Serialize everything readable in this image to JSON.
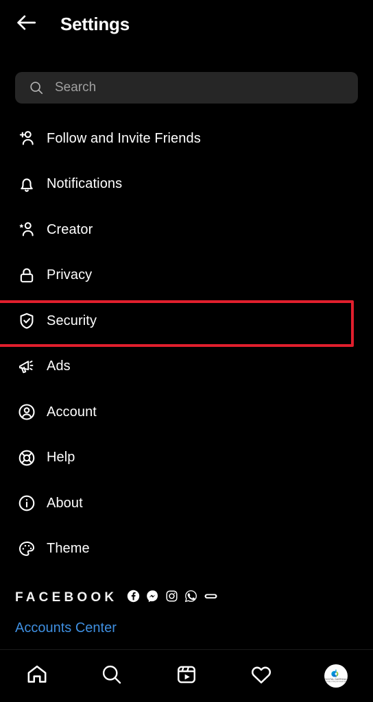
{
  "header": {
    "back_icon": "arrow-left-icon",
    "title": "Settings"
  },
  "search": {
    "icon": "search-icon",
    "placeholder": "Search",
    "value": ""
  },
  "menu": {
    "items": [
      {
        "label": "Follow and Invite Friends",
        "icon": "person-add-icon",
        "highlighted": false
      },
      {
        "label": "Notifications",
        "icon": "bell-icon",
        "highlighted": false
      },
      {
        "label": "Creator",
        "icon": "person-star-icon",
        "highlighted": false
      },
      {
        "label": "Privacy",
        "icon": "lock-icon",
        "highlighted": false
      },
      {
        "label": "Security",
        "icon": "shield-check-icon",
        "highlighted": true
      },
      {
        "label": "Ads",
        "icon": "megaphone-icon",
        "highlighted": false
      },
      {
        "label": "Account",
        "icon": "person-circle-icon",
        "highlighted": false
      },
      {
        "label": "Help",
        "icon": "lifebuoy-icon",
        "highlighted": false
      },
      {
        "label": "About",
        "icon": "info-circle-icon",
        "highlighted": false
      },
      {
        "label": "Theme",
        "icon": "palette-icon",
        "highlighted": false
      }
    ]
  },
  "facebook_section": {
    "wordmark": "FACEBOOK",
    "brand_icons": [
      "facebook-icon",
      "messenger-icon",
      "instagram-icon",
      "whatsapp-icon",
      "oculus-icon"
    ],
    "accounts_center_label": "Accounts Center"
  },
  "bottom_nav": {
    "items": [
      {
        "icon": "home-icon",
        "label": "Home"
      },
      {
        "icon": "search-icon",
        "label": "Search"
      },
      {
        "icon": "reels-icon",
        "label": "Reels"
      },
      {
        "icon": "heart-icon",
        "label": "Activity"
      },
      {
        "icon": "profile-avatar-icon",
        "label": "Profile"
      }
    ],
    "avatar_text": "DIGITAL DARPANA",
    "avatar_subtext": "we help u find your dream job"
  },
  "colors": {
    "background": "#000000",
    "search_field": "#262626",
    "highlight_red": "#e01f2d",
    "link_blue": "#3f8fe0",
    "text_primary": "#ffffff"
  }
}
